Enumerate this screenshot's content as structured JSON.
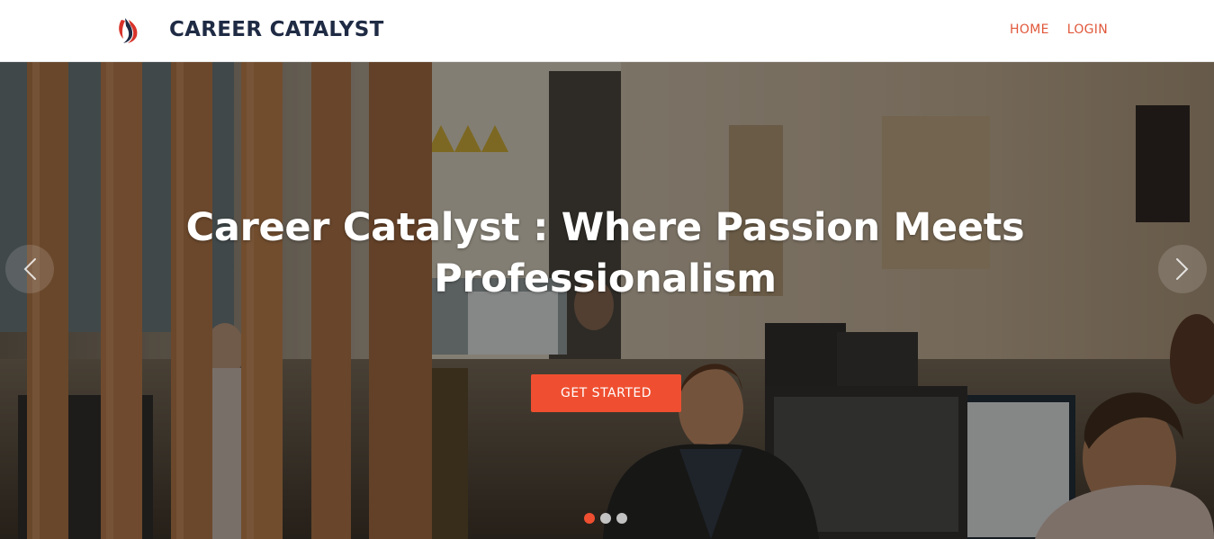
{
  "brand": {
    "name": "CAREER CATALYST",
    "logo_icon": "flame-logo-icon"
  },
  "nav": {
    "items": [
      "HOME",
      "LOGIN"
    ]
  },
  "hero": {
    "headline": "Career Catalyst :  Where Passion Meets Professionalism",
    "cta_label": "GET STARTED",
    "prev_icon": "chevron-left-icon",
    "next_icon": "chevron-right-icon",
    "slides_total": 3,
    "active_slide": 1
  },
  "colors": {
    "accent": "#ef4f30",
    "nav_link": "#e0583b",
    "brand_text": "#1f2b44"
  }
}
